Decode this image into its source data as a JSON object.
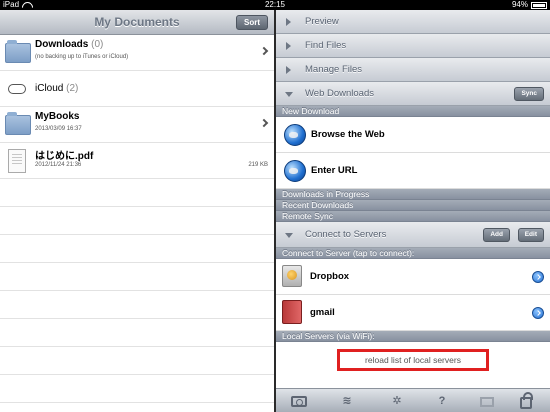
{
  "status_bar": {
    "device": "iPad",
    "time": "22:15",
    "battery": "94%"
  },
  "left_pane": {
    "title": "My Documents",
    "sort_label": "Sort",
    "files": [
      {
        "name": "Downloads",
        "count": "(0)",
        "sub": "(no backing up to iTunes or iCloud)",
        "size": "",
        "icon": "folder-icon"
      },
      {
        "name": "iCloud",
        "count": "(2)",
        "sub": "",
        "size": "",
        "icon": "cloud-icon"
      },
      {
        "name": "MyBooks",
        "count": "",
        "sub": "2013/03/09 16:37",
        "size": "",
        "icon": "folder-icon"
      },
      {
        "name": "はじめに.pdf",
        "count": "",
        "sub": "2012/11/24 21:36",
        "size": "219 KB",
        "icon": "pdf-icon"
      }
    ]
  },
  "right_pane": {
    "sections": {
      "preview": "Preview",
      "find_files": "Find Files",
      "manage_files": "Manage Files",
      "web_downloads": "Web Downloads",
      "connect_to_servers": "Connect to Servers"
    },
    "sync_label": "Sync",
    "add_label": "Add",
    "edit_label": "Edit",
    "new_download_header": "New Download",
    "browse_label": "Browse the Web",
    "enter_url_label": "Enter URL",
    "downloads_in_progress": "Downloads in Progress",
    "recent_downloads": "Recent Downloads",
    "remote_sync": "Remote Sync",
    "connect_header": "Connect to Server (tap to connect):",
    "servers": [
      {
        "name": "Dropbox",
        "icon": "dropbox-icon"
      },
      {
        "name": "gmail",
        "icon": "gmail-icon"
      }
    ],
    "local_servers_header": "Local Servers (via WiFi):",
    "reload_label": "reload list of local servers",
    "toolbar_icons": [
      "camera-icon",
      "wifi-icon",
      "gear-icon",
      "help-icon",
      "screen-icon",
      "lock-icon"
    ]
  },
  "colors": {
    "highlight_border": "#e02020"
  }
}
